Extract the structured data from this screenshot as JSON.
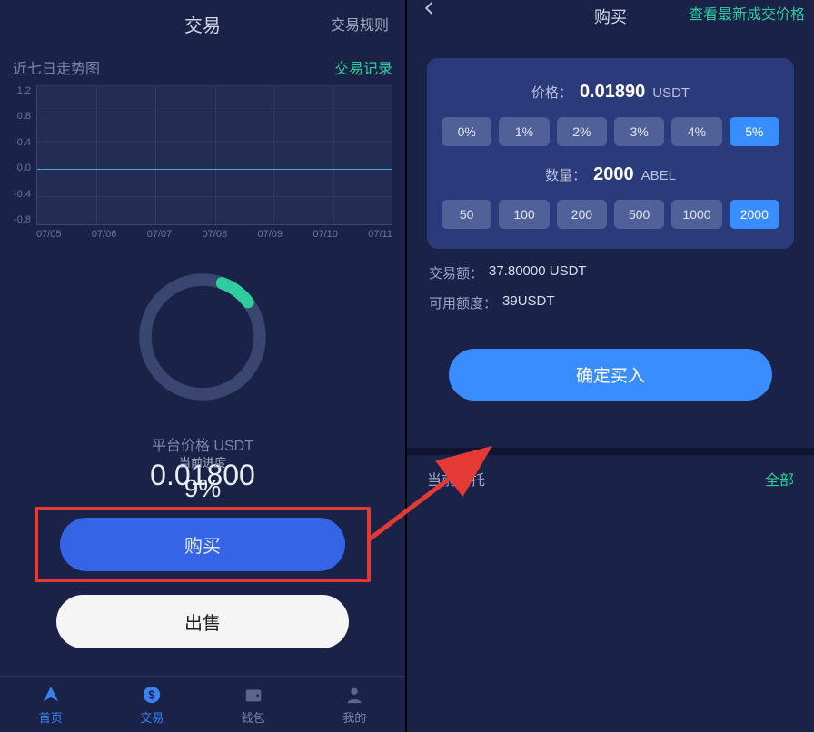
{
  "left": {
    "header_title": "交易",
    "header_right": "交易规则",
    "sub_left": "近七日走势图",
    "sub_right": "交易记录",
    "progress_label": "当前进度",
    "progress_value": "9%",
    "progress_percent": 9,
    "price_label": "平台价格 USDT",
    "price_value": "0.01800",
    "buy_label": "购买",
    "sell_label": "出售"
  },
  "chart_data": {
    "type": "line",
    "title": "近七日走势图",
    "xlabel": "",
    "ylabel": "",
    "ylim": [
      -0.8,
      1.2
    ],
    "y_ticks": [
      "1.2",
      "0.8",
      "0.4",
      "0.0",
      "-0.4",
      "-0.8"
    ],
    "x": [
      "07/05",
      "07/06",
      "07/07",
      "07/08",
      "07/09",
      "07/10",
      "07/11"
    ],
    "series": [
      {
        "name": "price",
        "values": [
          0.0,
          0.0,
          0.0,
          0.0,
          0.0,
          0.0,
          0.0
        ]
      }
    ]
  },
  "tabs": [
    {
      "label": "首页"
    },
    {
      "label": "交易"
    },
    {
      "label": "钱包"
    },
    {
      "label": "我的"
    }
  ],
  "right": {
    "title": "购买",
    "link": "查看最新成交价格",
    "price_label": "价格：",
    "price_value": "0.01890",
    "price_unit": "USDT",
    "pct_options": [
      "0%",
      "1%",
      "2%",
      "3%",
      "4%",
      "5%"
    ],
    "pct_selected": "5%",
    "qty_label": "数量：",
    "qty_value": "2000",
    "qty_unit": "ABEL",
    "qty_options": [
      "50",
      "100",
      "200",
      "500",
      "1000",
      "2000"
    ],
    "qty_selected": "2000",
    "amount_label": "交易额：",
    "amount_value": "37.80000 USDT",
    "avail_label": "可用额度：",
    "avail_value": "39USDT",
    "confirm_label": "确定买入",
    "entrust_label": "当前委托",
    "all_label": "全部"
  }
}
